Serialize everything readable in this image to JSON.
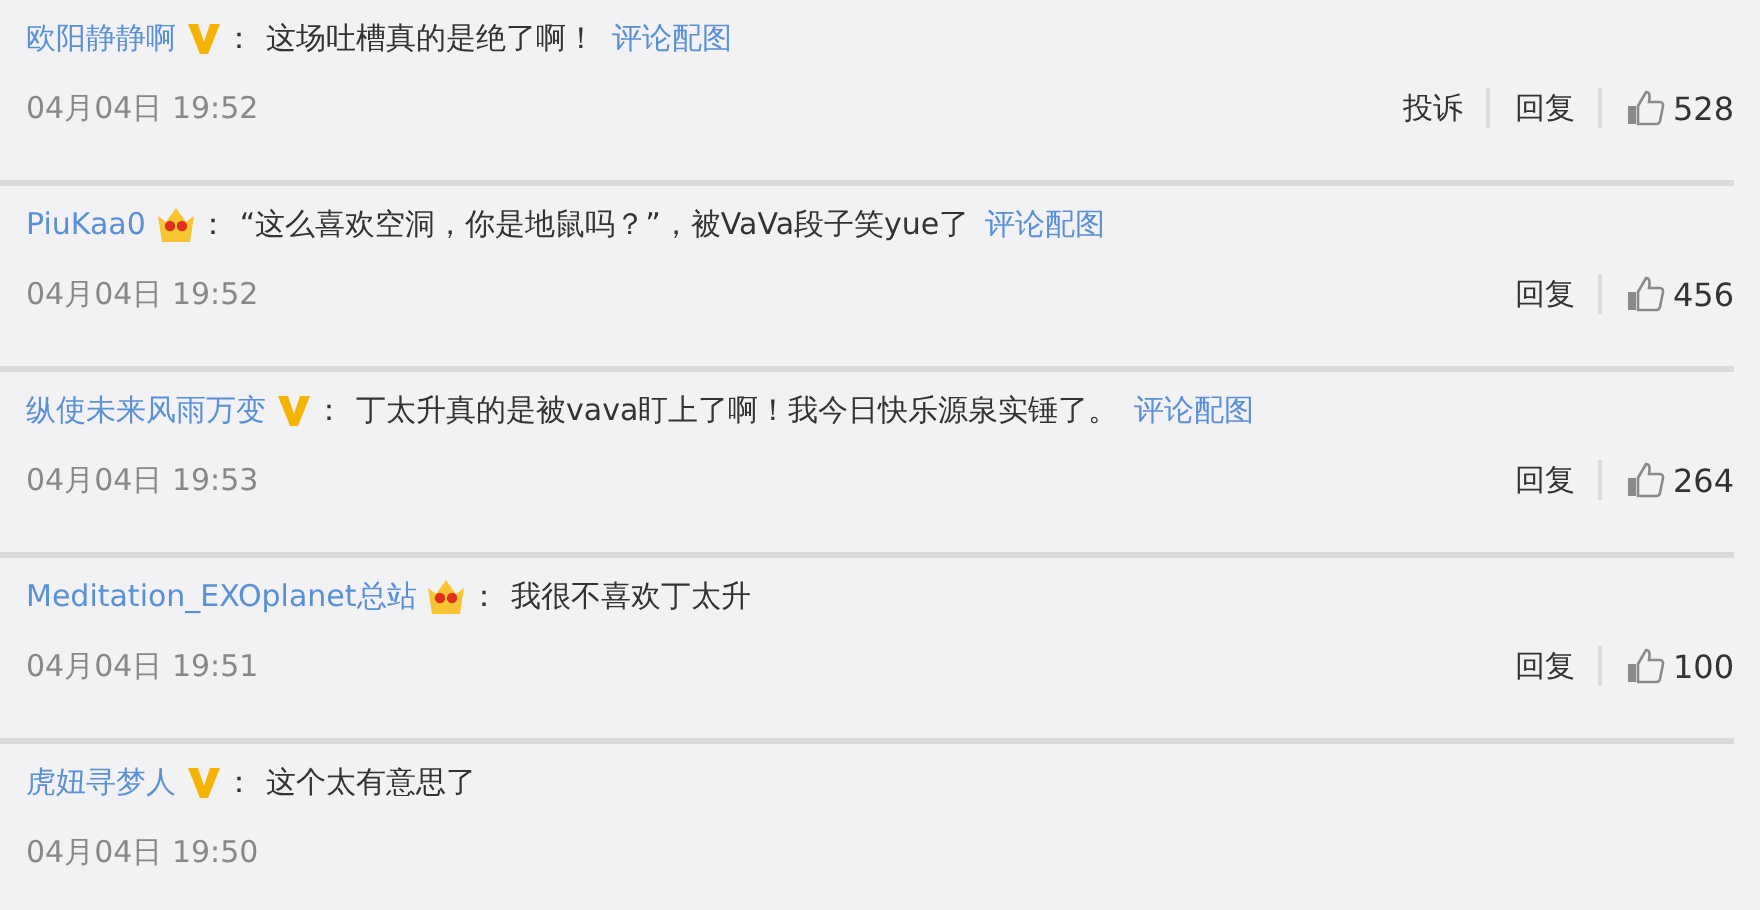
{
  "comments": [
    {
      "user": "欧阳静静啊",
      "kind": "v",
      "colon": "：",
      "text": "这场吐槽真的是绝了啊！",
      "link": "评论配图",
      "time": "04月04日 19:52",
      "actions": [
        "投诉",
        "回复"
      ],
      "likes": "528"
    },
    {
      "user": "PiuKaa0",
      "kind": "crown",
      "colon": "：",
      "text": "“这么喜欢空洞，你是地鼠吗？”，被VaVa段子笑yue了",
      "link": "评论配图",
      "time": "04月04日 19:52",
      "actions": [
        "回复"
      ],
      "likes": "456"
    },
    {
      "user": "纵使未来风雨万变",
      "kind": "v",
      "colon": "：",
      "text": "丁太升真的是被vava盯上了啊！我今日快乐源泉实锤了。",
      "link": "评论配图",
      "time": "04月04日 19:53",
      "actions": [
        "回复"
      ],
      "likes": "264"
    },
    {
      "user": "Meditation_EXOplanet总站",
      "kind": "crown",
      "colon": "：",
      "text": "我很不喜欢丁太升",
      "time": "04月04日 19:51",
      "actions": [
        "回复"
      ],
      "likes": "100"
    },
    {
      "user": "虎妞寻梦人",
      "kind": "v",
      "colon": "：",
      "text": "这个太有意思了",
      "time": "04月04日 19:50"
    }
  ]
}
